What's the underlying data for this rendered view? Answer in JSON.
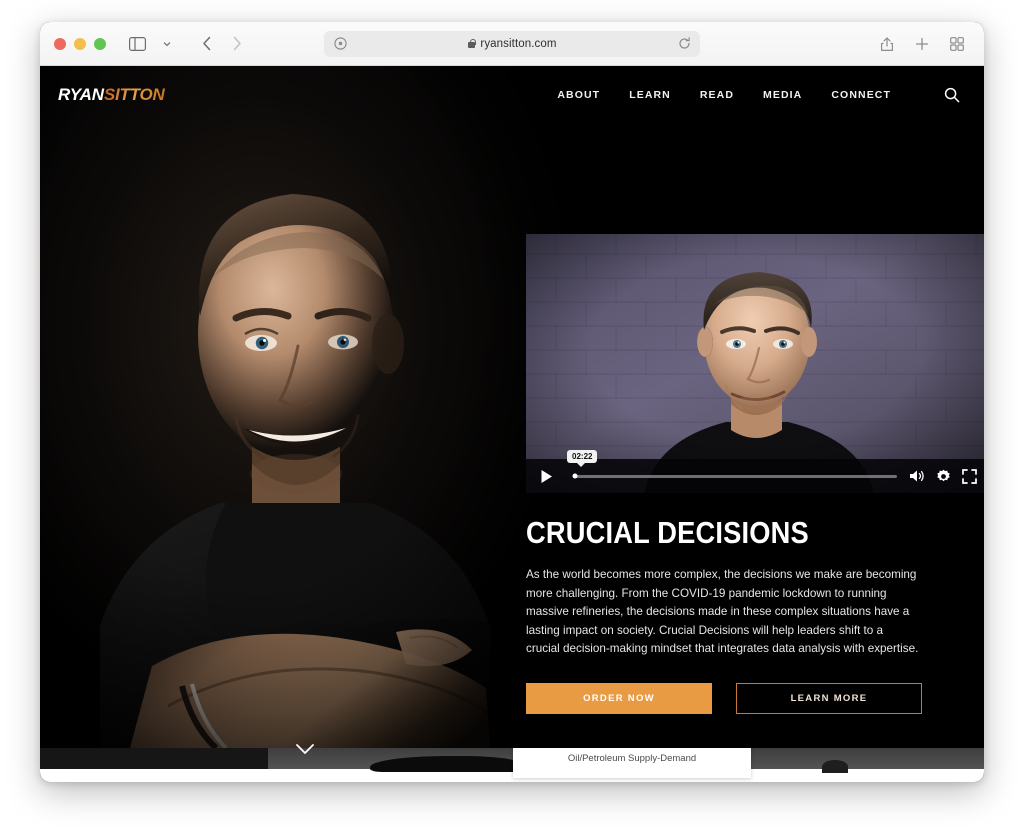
{
  "browser": {
    "url": "ryansitton.com",
    "lock_icon": "lock-icon",
    "reader_icon": "reader-view-icon",
    "reload_icon": "reload-icon",
    "sidebar_icon": "sidebar-toggle-icon",
    "back_icon": "back-arrow-icon",
    "forward_icon": "forward-arrow-icon",
    "shield_icon": "privacy-shield-icon",
    "share_icon": "share-icon",
    "newtab_icon": "plus-icon",
    "tabs_icon": "tab-overview-icon"
  },
  "site": {
    "logo": {
      "first": "RYAN",
      "second": "SITTON"
    },
    "nav": [
      {
        "label": "ABOUT"
      },
      {
        "label": "LEARN"
      },
      {
        "label": "READ"
      },
      {
        "label": "MEDIA"
      },
      {
        "label": "CONNECT"
      }
    ],
    "search_icon": "search-icon",
    "video": {
      "current_time": "02:22",
      "play_icon": "play-icon",
      "volume_icon": "volume-icon",
      "settings_icon": "gear-icon",
      "fullscreen_icon": "fullscreen-icon",
      "progress_percent": 0.6
    },
    "hero": {
      "headline": "CRUCIAL DECISIONS",
      "paragraph": "As the world becomes more complex, the decisions we make are becoming more challenging. From the COVID-19 pandemic lockdown to running massive refineries, the decisions made in these complex situations have a lasting impact on society. Crucial Decisions will help leaders shift to a crucial decision-making mindset that integrates data analysis with expertise.",
      "primary_button": "ORDER NOW",
      "secondary_button": "LEARN MORE"
    },
    "scroll_indicator_icon": "chevron-down-icon",
    "next_section": {
      "card_label": "Oil/Petroleum Supply-Demand"
    }
  },
  "colors": {
    "accent_orange": "#e89b43",
    "logo_orange": "#c4721f",
    "background": "#000000",
    "button_outline": "#c8793a"
  }
}
